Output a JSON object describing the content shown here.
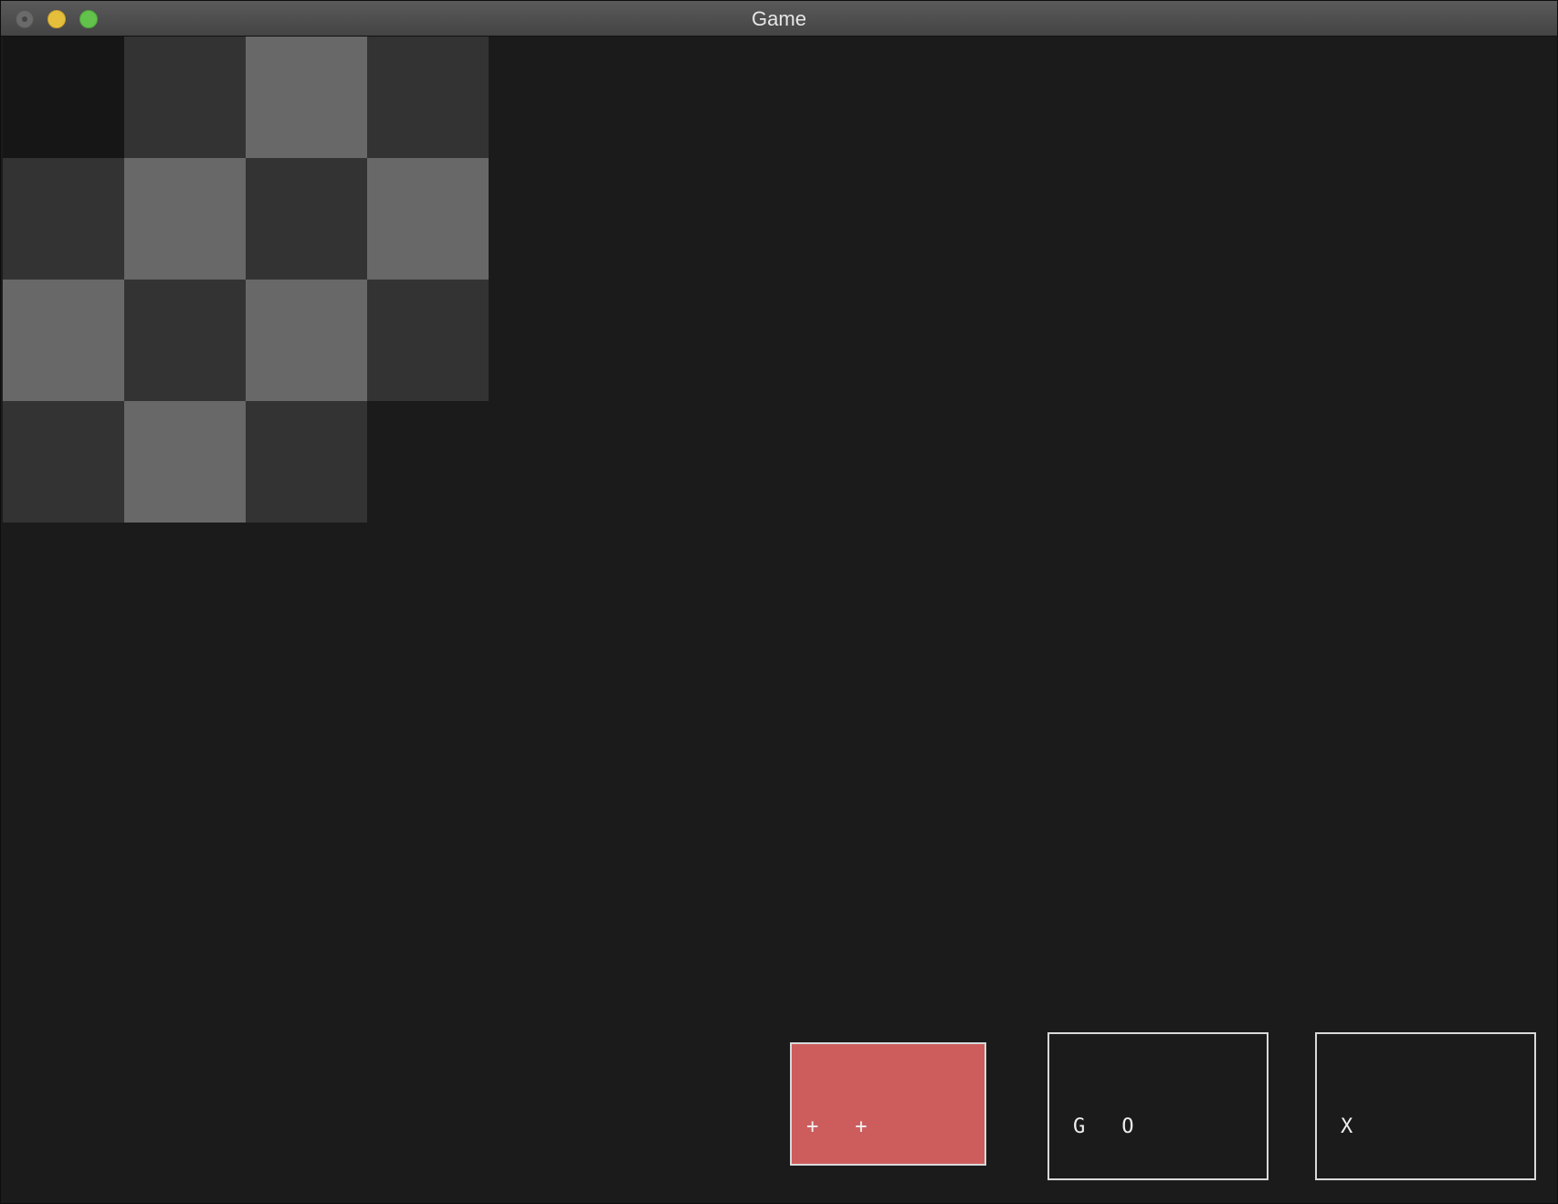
{
  "window": {
    "title": "Game"
  },
  "board": {
    "rows": 4,
    "cols": 4,
    "cells": [
      [
        "corner",
        "dark",
        "light",
        "dark"
      ],
      [
        "dark",
        "light",
        "dark",
        "light"
      ],
      [
        "light",
        "dark",
        "light",
        "dark"
      ],
      [
        "dark",
        "light",
        "dark",
        "empty"
      ]
    ],
    "colors": {
      "corner": "#161616",
      "dark": "#333333",
      "light": "#686868",
      "empty": "#1b1b1b"
    }
  },
  "buttons": {
    "plus": {
      "label": "++",
      "background": "#cd5d5d"
    },
    "go": {
      "label": "GO"
    },
    "close": {
      "label": "X"
    }
  },
  "colors": {
    "window_background": "#1b1b1b",
    "button_border": "#d9d9d9",
    "button_text": "#f0f0f0"
  }
}
